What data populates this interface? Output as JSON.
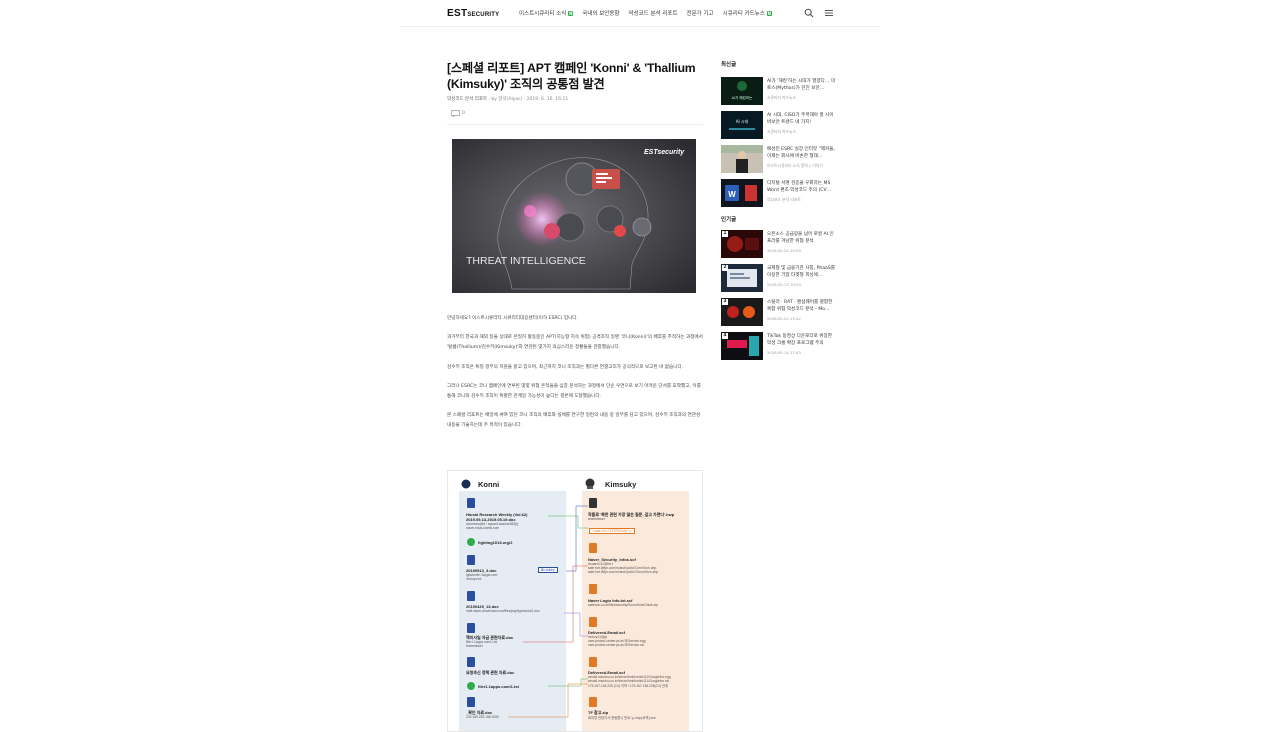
{
  "header": {
    "logo_main": "EST",
    "logo_sub": "SECURITY",
    "nav": [
      {
        "label": "이스트시큐리티 소식",
        "badge": "N"
      },
      {
        "label": "국내외 보안동향",
        "badge": ""
      },
      {
        "label": "악성코드 분석 리포트",
        "badge": ""
      },
      {
        "label": "전문가 기고",
        "badge": ""
      },
      {
        "label": "시큐리티 카드뉴스",
        "badge": "N"
      }
    ]
  },
  "article": {
    "title_line1": "[스페셜 리포트] APT 캠페인 'Konni' & 'Thallium",
    "title_line2": "(Kimsuky)' 조직의 공통점 발견",
    "category": "악성코드 분석 리포트",
    "meta": "· by 알약(Alyac) · 2019. 6. 10. 16:11",
    "comment_count": "0",
    "hero": {
      "brand": "ESTsecurity",
      "caption": "THREAT INTELLIGENCE"
    },
    "paragraphs": [
      "안녕하세요? 이스트시큐리티 시큐리티대응센터(이하 ESRC) 입니다.",
      "과거부터 한국과 해외 등을 상대로 은밀히 활동중인 APT(지능형 지속 위협) 공격조직 일명 '코니(Konni)'의 배후를 추적하는 과정에서 '탈륨(Thallium)/김수키(Kimsuky)'와 연관된 몇가지 의심스러운 정황들을 관찰했습니다.",
      "김수키 조직은 특정 정부의 지원을 받고 있으며, 최근까지 코니 조직과는 별다른 연결고리가 공식적으로 보고된 바 없습니다.",
      "그러나 ESRC는 코니 캠페인에 연루된 몇몇 위협 흔적들을 심층 분석하는 과정에서 단순 우연으로 보기 어려운 단서를 포착했고, 이를 통해 코니와 김수키 조직이 특별한 관계일 가능성이 높다는 결론에 도달했습니다.",
      "본 스페셜 리포트는 배일에 싸여 있던 코니 조직의 배후와 실체를 연구한 일련의 내용 중 일부를 담고 있으며, 김수키 조직과의 연관성 내용을 기술하는데 주 목적이 있습니다."
    ]
  },
  "diagram": {
    "konni_title": "Konni",
    "kimsuky_title": "Kimsuky",
    "konni_items": [
      {
        "title": "Hiusbi Research Weekly (Vol.62)",
        "title2": "2019.05.13-2019.05.19.doc",
        "sub": "victorious@d / squard-ksama/383(t)\nnaver.edus-ulomk.com"
      },
      {
        "title": "fighting1013.org/2",
        "sub": ""
      },
      {
        "title": "20190513_3.doc",
        "sub": "lgbubcefn.1apps.com\nvictory.exe"
      },
      {
        "title": "20190429_13.doc",
        "sub": "mail.naver-download.com/files/pay/typeword/1.doc"
      },
      {
        "title": "핵미사일 자금 관련자료.doc",
        "sub": "filer1.1apps.com/1.txt\nteamviewer"
      },
      {
        "title": "요청추신 정책 관련 자료.doc",
        "sub": ""
      },
      {
        "title": "filer1.1apps.com/1.txt",
        "sub": ""
      },
      {
        "title": "_확인 자료.doc",
        "sub": "202.169.225.156.3000"
      }
    ],
    "kimsuky_items": [
      {
        "title": "작품로 '북한 관련 가장 많은 질문, 깊고 가면다'.hwp",
        "sub": "teamviewer"
      },
      {
        "title": "Naver_Security_Infos.scf",
        "sub": "rfudanv111@fre.t\nsafe.fort.8tfyn.com/m/arch/pd/c//CmrnSrch.ahp\nsafe.fort.8tfyn.com/m/arch/pd/c//ChromSrch.ahp"
      },
      {
        "title": "Naver Login Info.txt.scf",
        "sub": "safeicon.co.kr/files/security/ScrunHnisCheck.zip"
      },
      {
        "title": "Delivered-Email.scf",
        "sub": "victory11@gt\nuser.protect-center.ps.kr/JEService.egg\nuser.protect-center.ps.kr/JEService.rar"
      },
      {
        "title": "Delivered-Email.scf",
        "sub": "windsl.mscdou.co.kr/forum/font/lon/sb111/Googlefox.egg\nwindsl.mscdou.co.kr/forum/font/lon/sb111/Googlefox.rar\n175.167.136.225 (C4) 이력 / 175.167.136.226(C4) 관계"
      },
      {
        "title": "TF 참고.zip",
        "sub": "회의방 관련이사-변동뿐니 반트 뉴.hwp(요백).exe"
      }
    ],
    "tag_blue": "Bluebky",
    "tag_orange": "<job id=\"VTSTVSAV\">"
  },
  "sidebar": {
    "recent_title": "최신글",
    "recent": [
      {
        "title": "AI가 '해킹'하는 시대가 열렸다… 미토스(Mythos)가 던진 보안…",
        "sub": "시큐리티 카드뉴스",
        "thumb_text": "AI가 해킹하는"
      },
      {
        "title": "AI 시대, CISO가 주목해야 할 사이버보안 트렌드 네 가지!",
        "sub": "시큐리티 카드뉴스",
        "thumb_text": "AI 시대"
      },
      {
        "title": "배성민 ESRC 실장 인터뷰 \"제커들, 이제는 회사에 버손한 형태…",
        "sub": "이스트시큐리티 소식 알약 L 이야기",
        "thumb_text": ""
      },
      {
        "title": "디지털 서명 검증을 우회하는 MS Word 편조 악성코드 주의 (CV…",
        "sub": "악성코드 분석 리포트",
        "thumb_text": "W"
      }
    ],
    "popular_title": "인기글",
    "popular": [
      {
        "rank": "1",
        "title": "오픈소스 공급망을 넘어 로컬 AI 인프라를 겨냥한 위협 분석",
        "sub": "2026.05.20 14:00"
      },
      {
        "rank": "2",
        "title": "국제형 및 금융기관 사칭, PhaaS를 이용한 기업 타겟형 피싱에…",
        "sub": "2026.05.13 10:34"
      },
      {
        "rank": "3",
        "title": "스틸러 · RAT · 랜섬웨어를 결합한 복합 위협 악성코드 분석 - Mo…",
        "sub": "2026.05.20 15:42"
      },
      {
        "rank": "4",
        "title": "TikTok 동영상 다운로더로 위장한 악성 크롬 확장 프로그램 주의",
        "sub": "2026.05.14 17:43"
      }
    ]
  },
  "colors": {
    "accent_green": "#2eae4a",
    "konni_blue": "#2b4f9e",
    "kimsuky_orange": "#e07a27"
  }
}
